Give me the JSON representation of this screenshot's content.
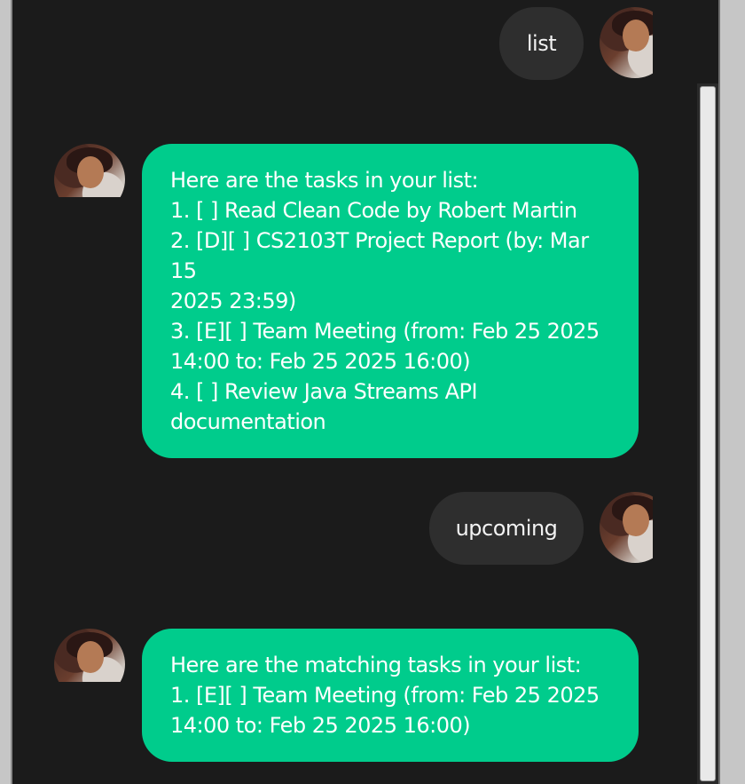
{
  "messages": [
    {
      "role": "user",
      "text": "list"
    },
    {
      "role": "bot",
      "lines": [
        "Here are the tasks in your list:",
        "1. [ ] Read Clean Code by Robert Martin",
        "2. [D][ ] CS2103T Project Report (by: Mar 15",
        "2025 23:59)",
        "3. [E][ ] Team Meeting (from: Feb 25 2025",
        "14:00 to: Feb 25 2025 16:00)",
        "4. [ ] Review Java Streams API",
        "documentation"
      ]
    },
    {
      "role": "user",
      "text": "upcoming"
    },
    {
      "role": "bot",
      "lines": [
        "Here are the matching tasks in your list:",
        "1. [E][ ] Team Meeting (from: Feb 25 2025",
        "14:00 to: Feb 25 2025 16:00)"
      ]
    }
  ],
  "colors": {
    "background": "#1b1b1b",
    "user_bubble": "#2e2e2e",
    "bot_bubble": "#00cc8c",
    "text": "#ffffff"
  },
  "icons": {
    "user_avatar": "user-avatar-icon",
    "bot_avatar": "bot-avatar-icon"
  }
}
